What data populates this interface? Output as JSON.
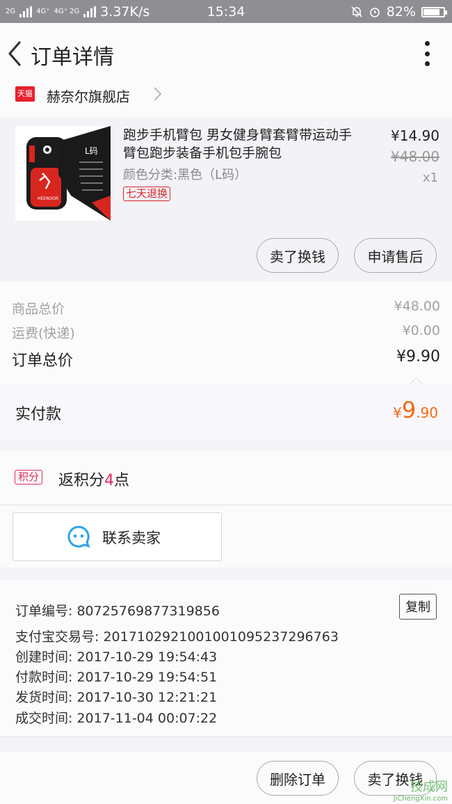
{
  "status_bar": {
    "net_left": "2G",
    "net_mid": "4G⁺",
    "net_mid2": "4G⁺ 2G",
    "speed": "3.37K/s",
    "time": "15:34",
    "battery": "82%",
    "battery_level": 0.82
  },
  "header": {
    "title": "订单详情"
  },
  "shop": {
    "badge": "天猫",
    "name": "赫奈尔旗舰店"
  },
  "product": {
    "title": "跑步手机臂包 男女健身臂套臂带运动手臂包跑步装备手机包手腕包",
    "sku": "颜色分类:黑色（L码）",
    "return_policy": "七天退换",
    "price_now": "¥14.90",
    "price_original": "¥48.00",
    "quantity": "x1",
    "thumb_label": "L码",
    "thumb_brand": "HEENOOR",
    "actions": {
      "sell_for_cash": "卖了换钱",
      "after_sales": "申请售后"
    }
  },
  "totals": {
    "goods_total_label": "商品总价",
    "goods_total_value": "¥48.00",
    "shipping_label": "运费(快递)",
    "shipping_value": "¥0.00",
    "order_total_label": "订单总价",
    "order_total_value": "¥9.90"
  },
  "payment": {
    "label": "实付款",
    "currency": "¥",
    "amount_int": "9",
    "amount_dec": ".90"
  },
  "points": {
    "badge": "积分",
    "text_before": "返积分",
    "value": "4",
    "text_after": "点"
  },
  "contact": {
    "label": "联系卖家"
  },
  "order_info": {
    "copy_label": "复制",
    "lines": [
      "订单编号: 80725769877319856",
      "支付宝交易号: 2017102921001001095237296763",
      "创建时间: 2017-10-29 19:54:43",
      "付款时间: 2017-10-29 19:54:51",
      "发货时间: 2017-10-30 12:21:21",
      "成交时间: 2017-11-04 00:07:22"
    ]
  },
  "bottom_bar": {
    "delete_order": "删除订单",
    "sell_for_cash": "卖了换钱"
  },
  "watermark": {
    "site": "JiChengXin.com",
    "mark": "技成网"
  },
  "colors": {
    "accent_price": "#f06a13",
    "tmall_red": "#e8202c",
    "points_pink": "#e22b5a",
    "status_bar": "#8f8f93"
  }
}
